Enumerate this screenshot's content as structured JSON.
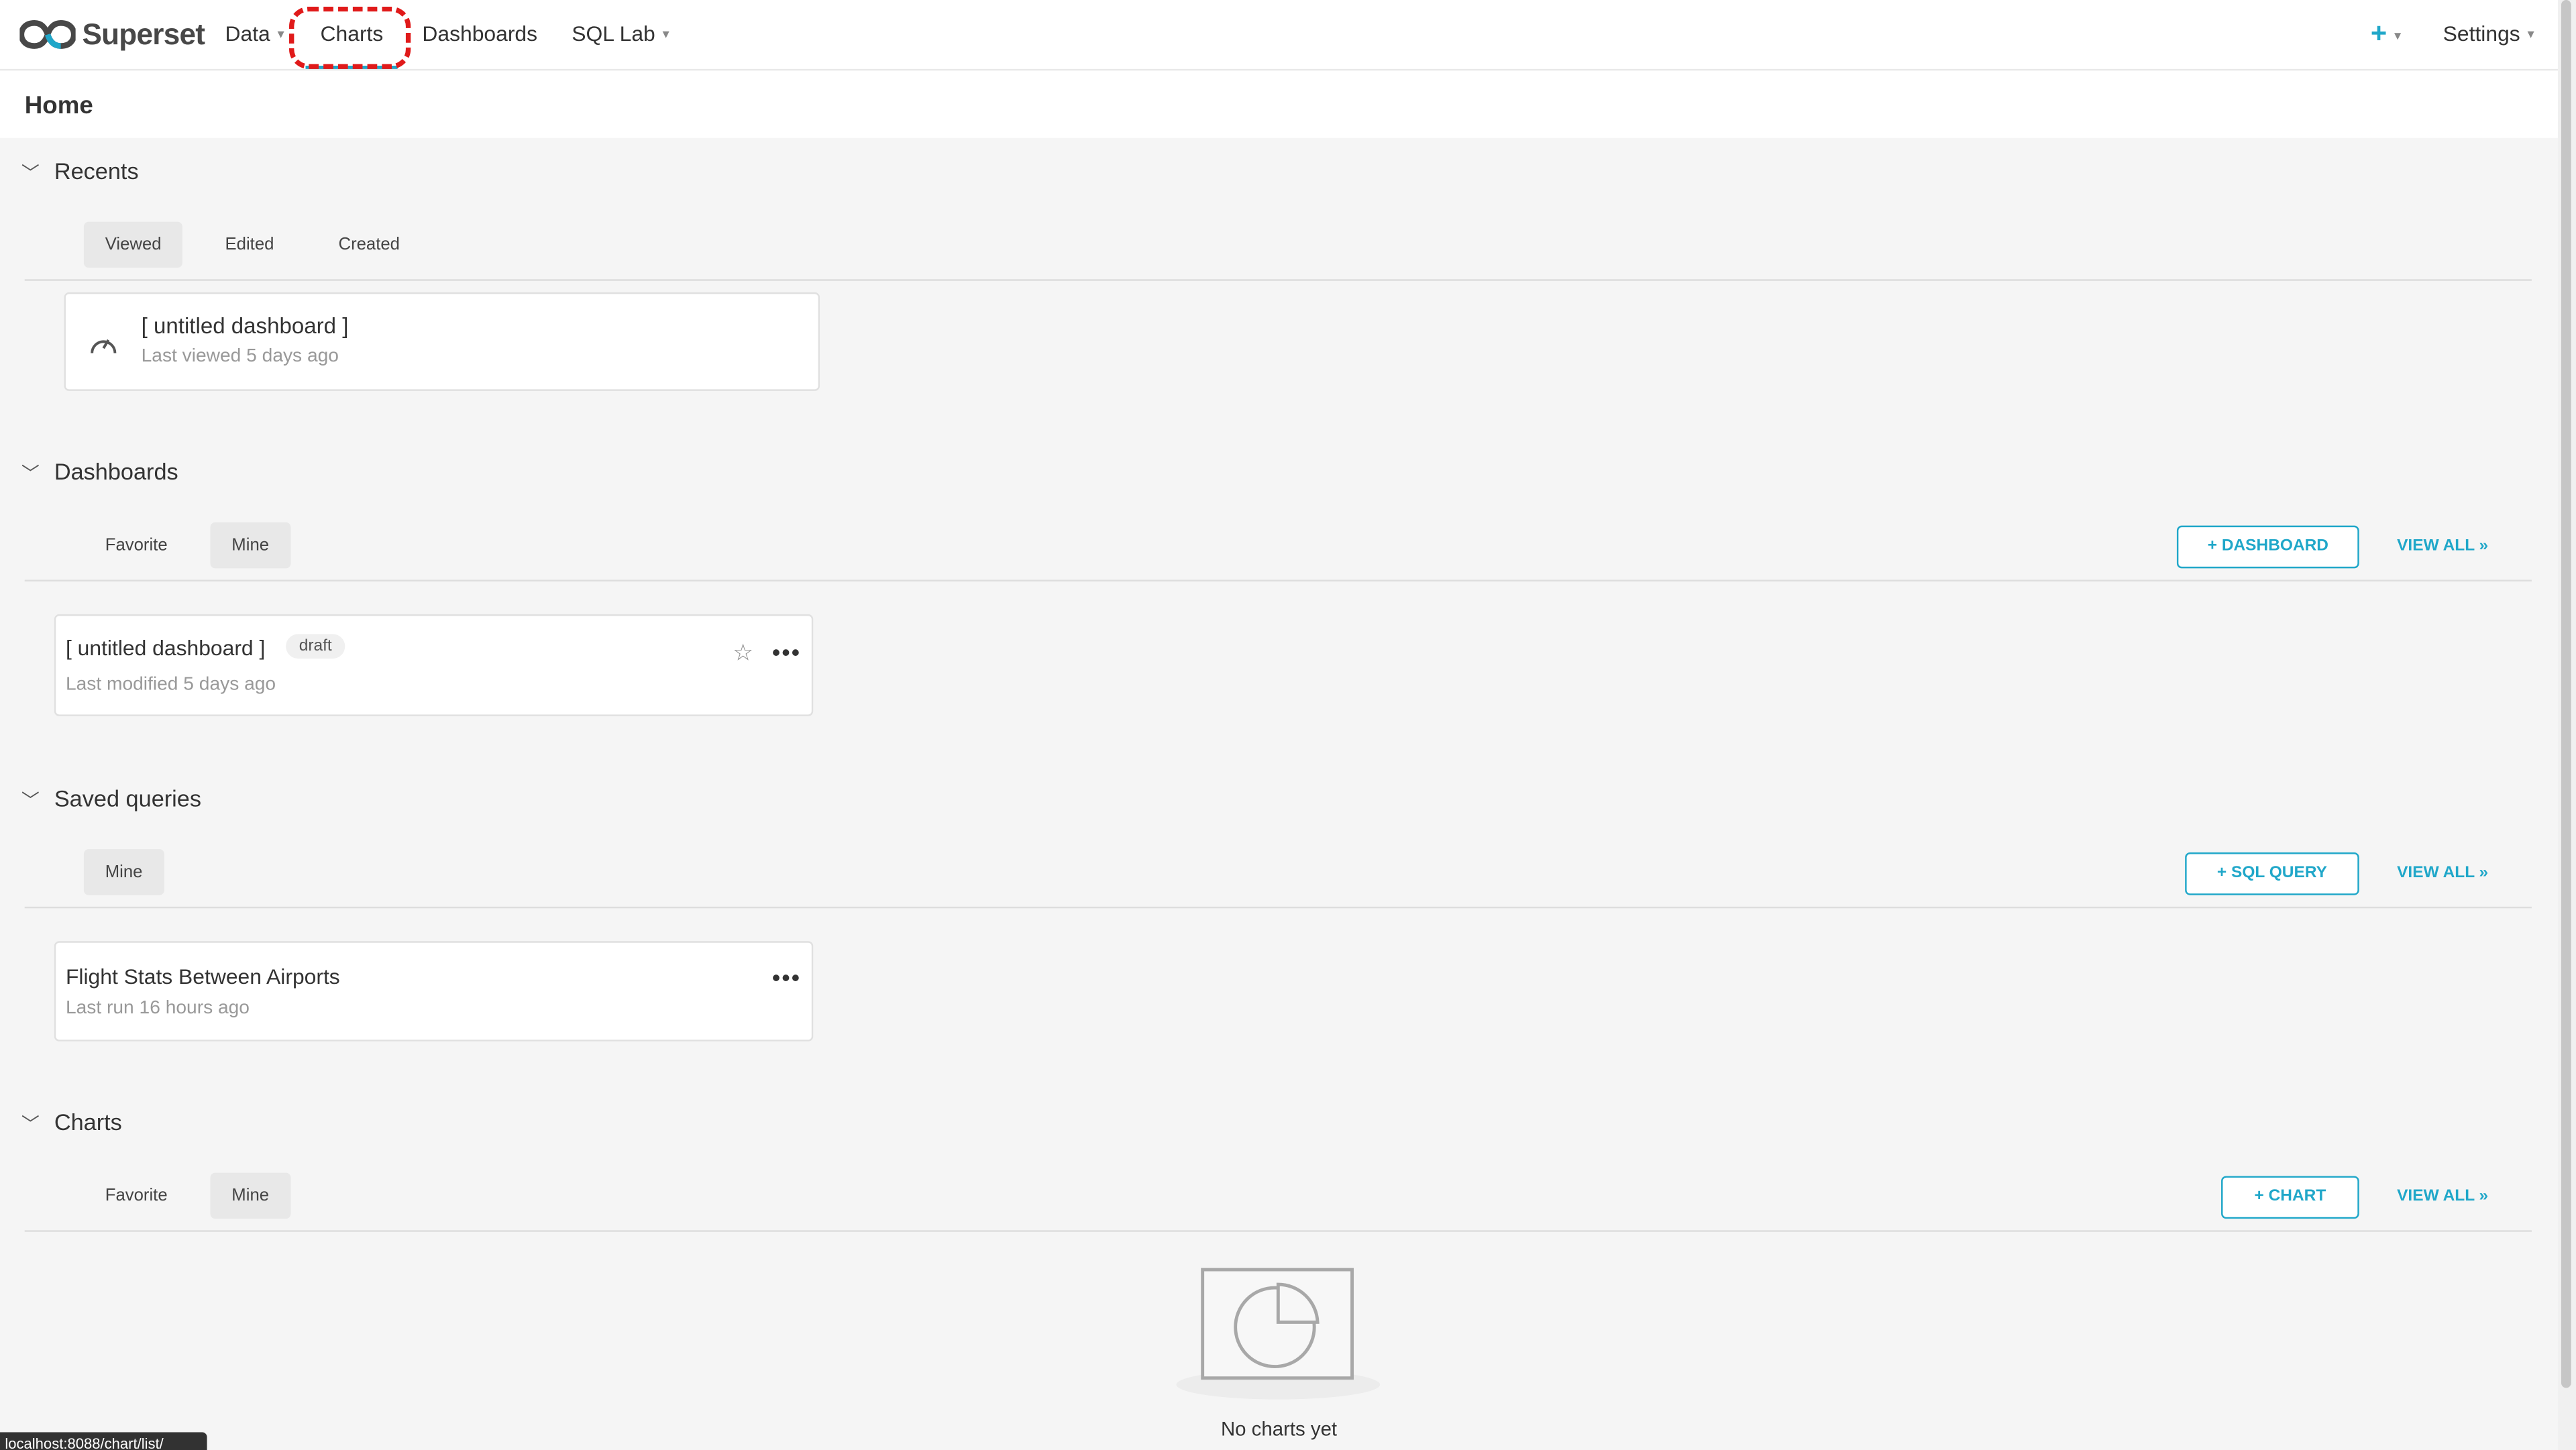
{
  "nav": {
    "brand": "Superset",
    "items": {
      "data": "Data",
      "charts": "Charts",
      "dashboards": "Dashboards",
      "sql_lab": "SQL Lab"
    },
    "plus": "+",
    "settings": "Settings"
  },
  "page": {
    "title": "Home"
  },
  "recents": {
    "title": "Recents",
    "tabs": {
      "viewed": "Viewed",
      "edited": "Edited",
      "created": "Created"
    },
    "active_tab": "Viewed",
    "card": {
      "title": "[ untitled dashboard ]",
      "subtitle": "Last viewed 5 days ago",
      "icon": "dashboard-gauge-icon"
    }
  },
  "dashboards": {
    "title": "Dashboards",
    "tabs": {
      "favorite": "Favorite",
      "mine": "Mine"
    },
    "active_tab": "Mine",
    "add_button": "DASHBOARD",
    "view_all": "VIEW ALL »",
    "card": {
      "title": "[ untitled dashboard ]",
      "badge": "draft",
      "subtitle": "Last modified 5 days ago"
    }
  },
  "saved_queries": {
    "title": "Saved queries",
    "tabs": {
      "mine": "Mine"
    },
    "active_tab": "Mine",
    "add_button": "SQL QUERY",
    "view_all": "VIEW ALL »",
    "card": {
      "title": "Flight Stats Between Airports",
      "subtitle": "Last run 16 hours ago"
    }
  },
  "charts": {
    "title": "Charts",
    "tabs": {
      "favorite": "Favorite",
      "mine": "Mine"
    },
    "active_tab": "Mine",
    "add_button": "CHART",
    "view_all": "VIEW ALL »",
    "empty_text": "No charts yet"
  },
  "status_url": "localhost:8088/chart/list/",
  "colors": {
    "accent": "#20a7c9",
    "highlight": "#e01a1a",
    "background": "#f5f5f5"
  }
}
